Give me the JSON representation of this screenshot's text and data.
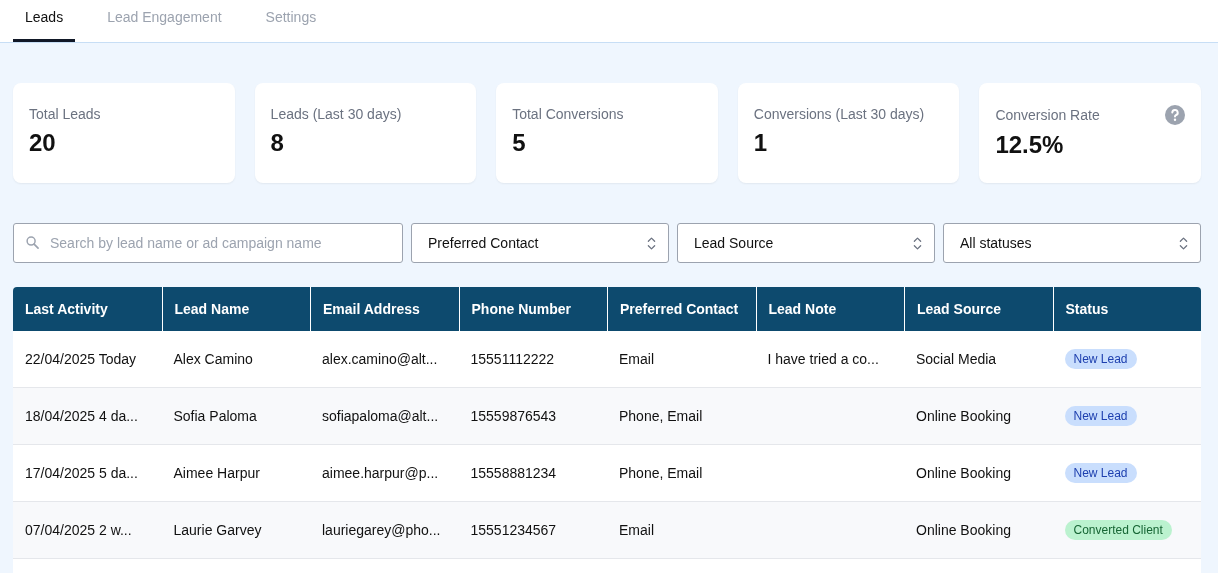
{
  "tabs": [
    {
      "label": "Leads",
      "selected": true
    },
    {
      "label": "Lead Engagement",
      "selected": false
    },
    {
      "label": "Settings",
      "selected": false
    }
  ],
  "stats": [
    {
      "label": "Total Leads",
      "value": "20"
    },
    {
      "label": "Leads (Last 30 days)",
      "value": "8"
    },
    {
      "label": "Total Conversions",
      "value": "5"
    },
    {
      "label": "Conversions (Last 30 days)",
      "value": "1"
    },
    {
      "label": "Conversion Rate",
      "value": "12.5%",
      "help": true
    }
  ],
  "search": {
    "placeholder": "Search by lead name or ad campaign name"
  },
  "filters": [
    "Preferred Contact",
    "Lead Source",
    "All statuses"
  ],
  "table": {
    "columns": [
      "Last Activity",
      "Lead Name",
      "Email Address",
      "Phone Number",
      "Preferred Contact",
      "Lead Note",
      "Lead Source",
      "Status"
    ],
    "rows": [
      {
        "last_activity": "22/04/2025 Today",
        "name": "Alex Camino",
        "email": "alex.camino@alt...",
        "phone": "15551112222",
        "contact": "Email",
        "note": "I have tried a co...",
        "source": "Social Media",
        "status": {
          "label": "New Lead",
          "kind": "new"
        }
      },
      {
        "last_activity": "18/04/2025 4 da...",
        "name": "Sofia Paloma",
        "email": "sofiapaloma@alt...",
        "phone": "15559876543",
        "contact": "Phone, Email",
        "source": "Online Booking",
        "status": {
          "label": "New Lead",
          "kind": "new"
        }
      },
      {
        "last_activity": "17/04/2025 5 da...",
        "name": "Aimee Harpur",
        "email": "aimee.harpur@p...",
        "phone": "15558881234",
        "contact": "Phone, Email",
        "source": "Online Booking",
        "status": {
          "label": "New Lead",
          "kind": "new"
        }
      },
      {
        "last_activity": "07/04/2025 2 w...",
        "name": "Laurie Garvey",
        "email": "lauriegarey@pho...",
        "phone": "15551234567",
        "contact": "Email",
        "source": "Online Booking",
        "status": {
          "label": "Converted Client",
          "kind": "converted"
        }
      }
    ]
  }
}
